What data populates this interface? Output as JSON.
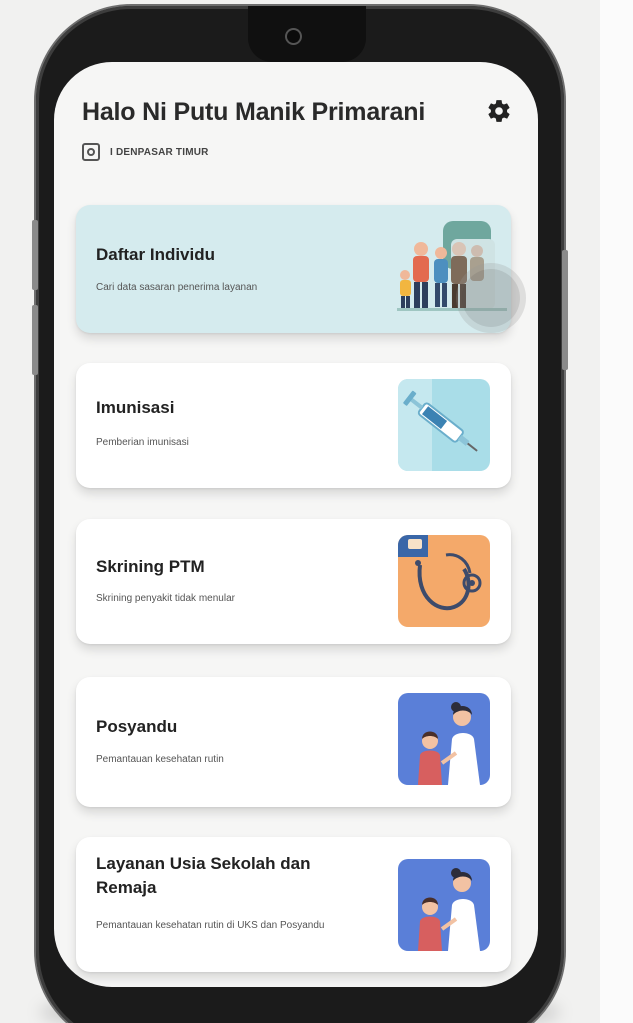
{
  "header": {
    "greeting": "Halo Ni Putu Manik Primarani",
    "location": "I DENPASAR TIMUR",
    "settings_icon": "gear-icon",
    "location_icon": "location-box-icon"
  },
  "menu": [
    {
      "title": "Daftar Individu",
      "desc": "Cari data sasaran penerima layanan",
      "image": "family-illustration"
    },
    {
      "title": "Imunisasi",
      "desc": "Pemberian imunisasi",
      "image": "syringe-illustration"
    },
    {
      "title": "Skrining PTM",
      "desc": "Skrining penyakit tidak menular",
      "image": "stethoscope-illustration"
    },
    {
      "title": "Posyandu",
      "desc": "Pemantauan kesehatan rutin",
      "image": "doctor-child-illustration"
    },
    {
      "title": "Layanan Usia Sekolah dan Remaja",
      "desc": "Pemantauan kesehatan rutin di UKS dan Posyandu",
      "image": "doctor-child-illustration"
    }
  ],
  "colors": {
    "active_card": "#d5ebee",
    "card": "#ffffff",
    "screen_bg": "#f6f6f5",
    "phone_body": "#1b1b1b"
  }
}
